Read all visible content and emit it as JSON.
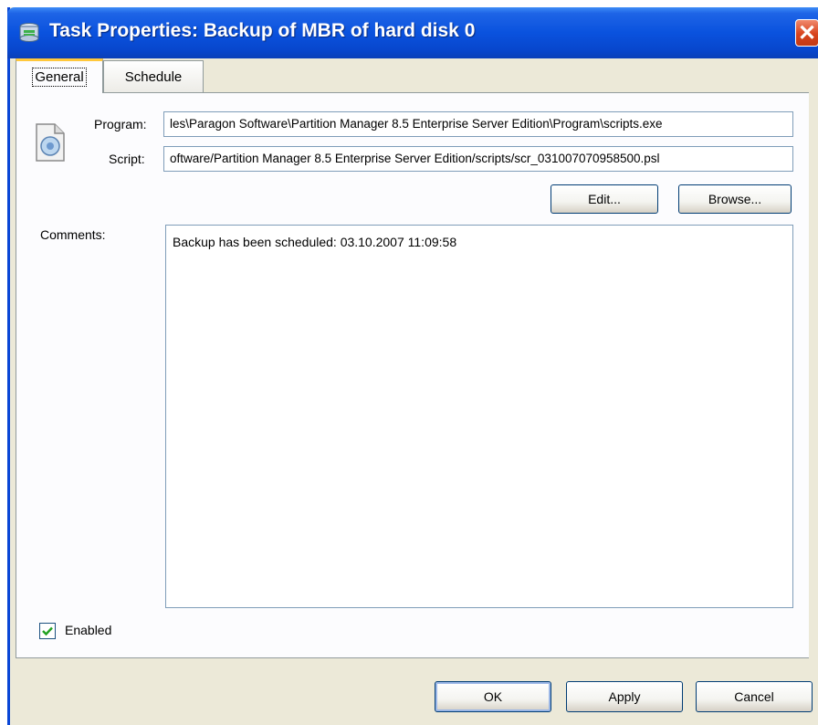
{
  "window": {
    "title": "Task Properties: Backup of MBR of hard disk 0",
    "close_glyph": "✕"
  },
  "tabs": [
    {
      "label": "General",
      "selected": true
    },
    {
      "label": "Schedule",
      "selected": false
    }
  ],
  "general": {
    "program_label": "Program:",
    "program_value": "les\\Paragon Software\\Partition Manager 8.5 Enterprise Server Edition\\Program\\scripts.exe",
    "script_label": "Script:",
    "script_value": "oftware/Partition Manager 8.5 Enterprise Server Edition/scripts/scr_031007070958500.psl",
    "edit_button": "Edit...",
    "browse_button": "Browse...",
    "comments_label": "Comments:",
    "comments_value": "Backup has been scheduled: 03.10.2007 11:09:58",
    "enabled_label": "Enabled",
    "enabled_checked": true
  },
  "footer": {
    "ok_button": "OK",
    "apply_button": "Apply",
    "cancel_button": "Cancel"
  },
  "colors": {
    "titlebar": "#0a52de",
    "window_bg": "#ece9d8",
    "tab_highlight": "#ffc83c",
    "close_button": "#d8431d"
  }
}
